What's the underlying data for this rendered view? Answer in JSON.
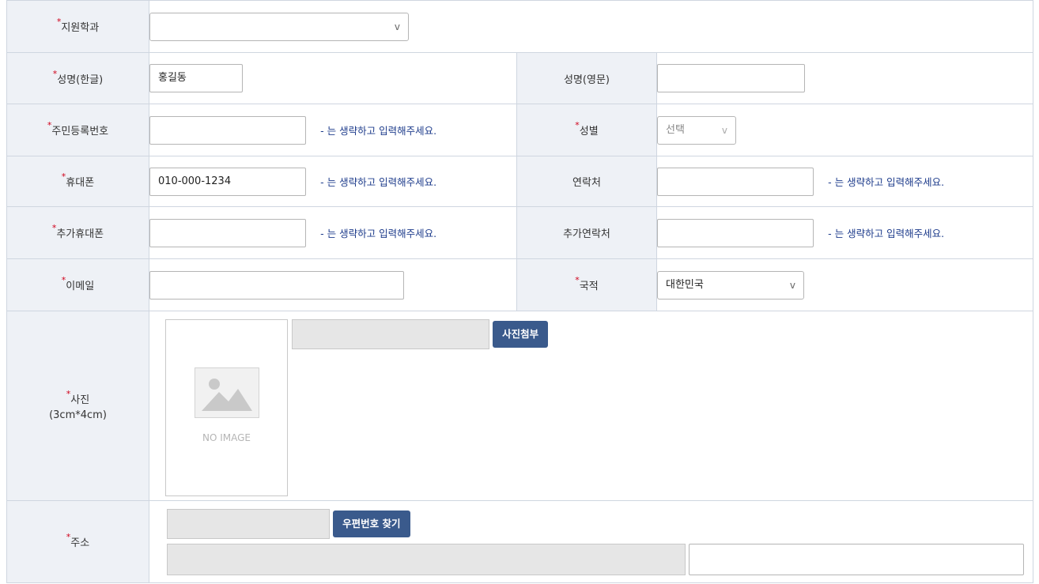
{
  "required_mark": "*",
  "rows": {
    "department": {
      "label": "지원학과",
      "value": "",
      "chevron": "v"
    },
    "name_kr": {
      "label": "성명(한글)",
      "value": "홍길동"
    },
    "name_en": {
      "label": "성명(영문)",
      "value": ""
    },
    "resident_no": {
      "label": "주민등록번호",
      "value": "",
      "hint": "- 는 생략하고 입력해주세요."
    },
    "gender": {
      "label": "성별",
      "value": "선택",
      "chevron": "v"
    },
    "mobile": {
      "label": "휴대폰",
      "value": "010-000-1234",
      "hint": "- 는 생략하고 입력해주세요."
    },
    "contact": {
      "label": "연락처",
      "value": "",
      "hint": "- 는 생략하고 입력해주세요."
    },
    "extra_mobile": {
      "label": "추가휴대폰",
      "value": "",
      "hint": "- 는 생략하고 입력해주세요."
    },
    "extra_contact": {
      "label": "추가연락처",
      "value": "",
      "hint": "- 는 생략하고 입력해주세요."
    },
    "email": {
      "label": "이메일",
      "value": ""
    },
    "nationality": {
      "label": "국적",
      "value": "대한민국",
      "chevron": "v"
    },
    "photo": {
      "label": "사진",
      "sublabel": "(3cm*4cm)",
      "placeholder": "NO IMAGE",
      "button": "사진첨부"
    },
    "address": {
      "label": "주소",
      "button": "우편번호 찾기",
      "detail": ""
    }
  },
  "colors": {
    "label_bg": "#eef1f6",
    "border": "#cfd6e0",
    "hint": "#1f3d8c",
    "button": "#3a5a8c",
    "required": "#d0021b"
  },
  "icons": {
    "photo_placeholder": "image-placeholder-icon"
  }
}
